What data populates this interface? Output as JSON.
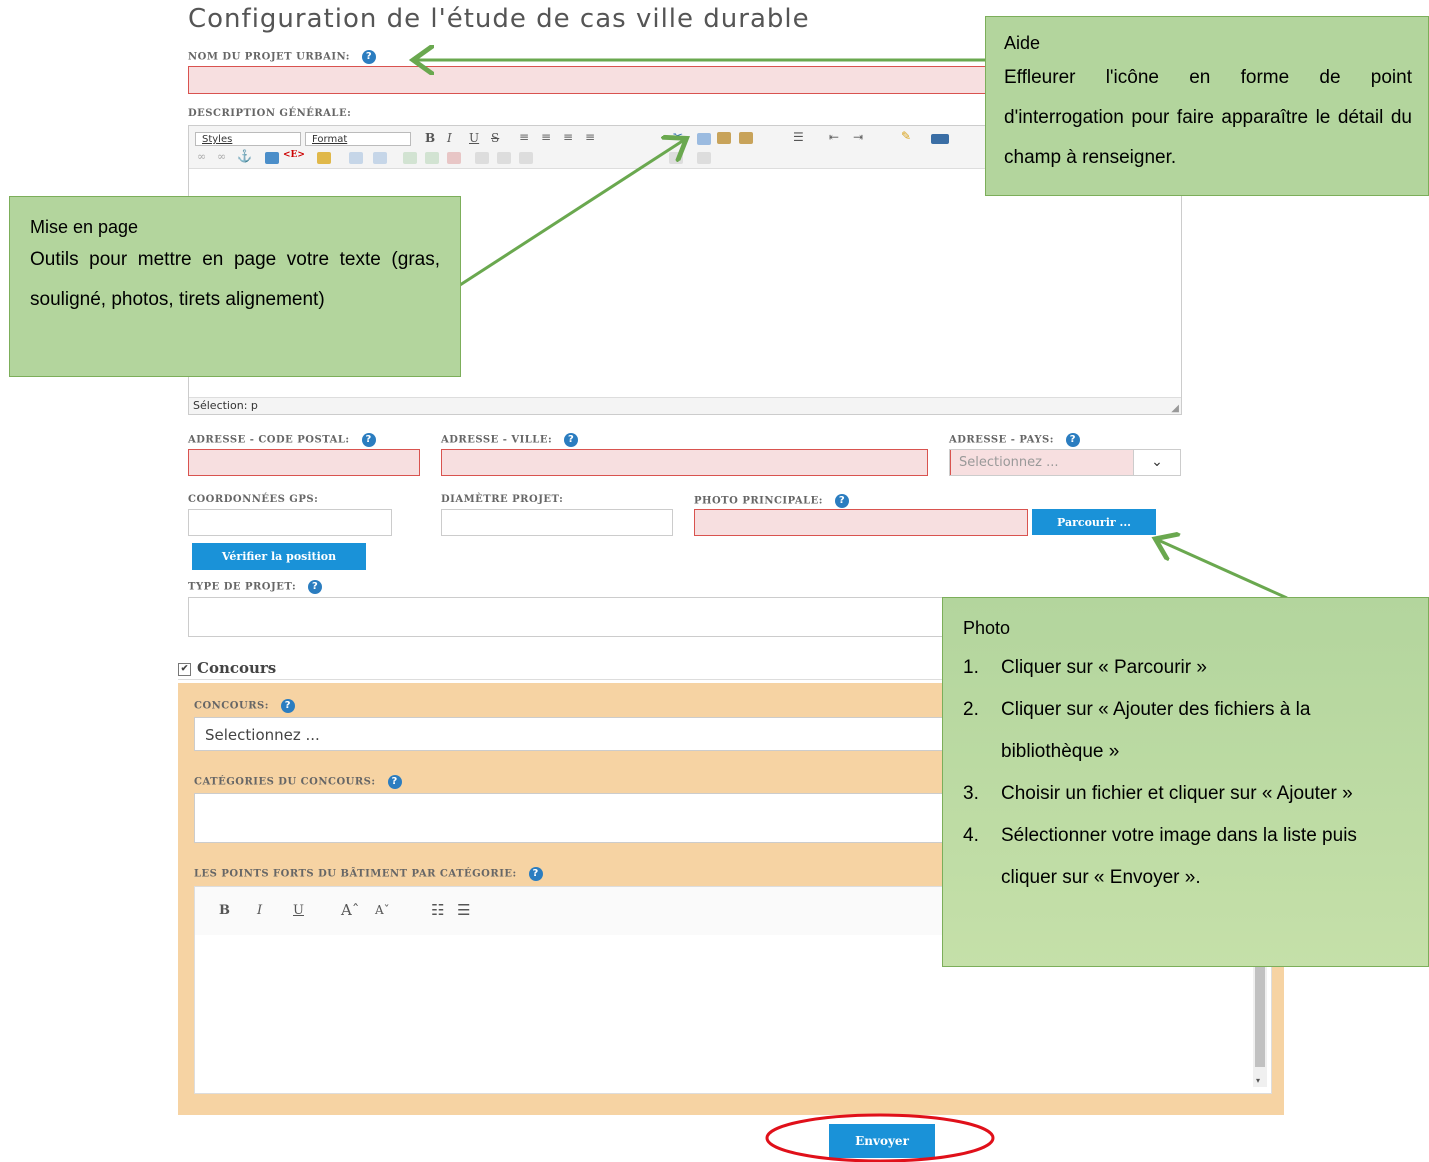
{
  "page": {
    "title": "Configuration de l'étude de cas ville durable"
  },
  "fields": {
    "nom_projet": "NOM DU PROJET URBAIN:",
    "description": "DESCRIPTION GÉNÉRALE:",
    "code_postal": "ADRESSE - CODE POSTAL:",
    "ville": "ADRESSE - VILLE:",
    "pays": "ADRESSE - PAYS:",
    "pays_placeholder": "Selectionnez ...",
    "gps": "COORDONNÉES GPS:",
    "diametre": "DIAMÈTRE PROJET:",
    "photo": "PHOTO PRINCIPALE:",
    "type_projet": "TYPE DE PROJET:"
  },
  "editor": {
    "styles": "Styles",
    "format": "Format",
    "status": "Sélection: p"
  },
  "buttons": {
    "parcourir": "Parcourir ...",
    "verifier": "Vérifier la position",
    "envoyer": "Envoyer"
  },
  "concours": {
    "checkbox_label": "Concours",
    "concours_label": "CONCOURS:",
    "concours_placeholder": "Selectionnez ...",
    "categories_label": "CATÉGORIES DU CONCOURS:",
    "points_forts_label": "LES POINTS FORTS DU BÂTIMENT PAR CATÉGORIE:"
  },
  "callouts": {
    "aide": {
      "title": "Aide",
      "text": "Effleurer l'icône en forme de point d'interrogation pour faire apparaître le détail du champ à renseigner."
    },
    "mise_en_page": {
      "title": "Mise en page",
      "text": "Outils pour mettre en page votre texte (gras, souligné, photos, tirets alignement)"
    },
    "photo": {
      "title": "Photo",
      "steps": [
        {
          "num": "1.",
          "text": "Cliquer sur « Parcourir »"
        },
        {
          "num": "2.",
          "text": "Cliquer sur « Ajouter des fichiers à la bibliothèque »"
        },
        {
          "num": "3.",
          "text": "Choisir un fichier et cliquer sur « Ajouter »"
        },
        {
          "num": "4.",
          "text": "Sélectionner votre image dans la liste puis cliquer sur « Envoyer »."
        }
      ]
    }
  },
  "colors": {
    "accent_blue": "#1a92d8",
    "callout_green": "#b3d59d",
    "arrow_green": "#6aa84f",
    "panel_orange": "#f6d3a3",
    "required_pink": "#f7dfe0",
    "highlight_red": "#e0101a"
  }
}
